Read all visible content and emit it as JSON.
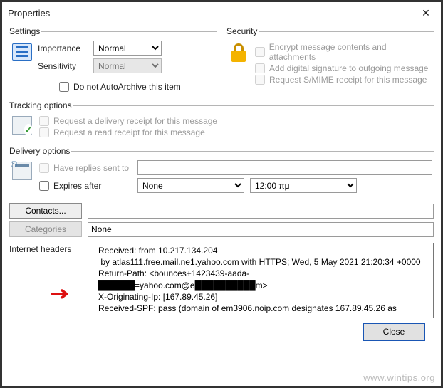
{
  "window": {
    "title": "Properties"
  },
  "settings": {
    "legend": "Settings",
    "importance_label": "Importance",
    "importance_value": "Normal",
    "sensitivity_label": "Sensitivity",
    "sensitivity_value": "Normal",
    "autoarchive_label": "Do not AutoArchive this item"
  },
  "security": {
    "legend": "Security",
    "encrypt_label": "Encrypt message contents and attachments",
    "sign_label": "Add digital signature to outgoing message",
    "smime_label": "Request S/MIME receipt for this message"
  },
  "tracking": {
    "legend": "Tracking options",
    "delivery_receipt_label": "Request a delivery receipt for this message",
    "read_receipt_label": "Request a read receipt for this message"
  },
  "delivery": {
    "legend": "Delivery options",
    "replies_label": "Have replies sent to",
    "replies_value": "",
    "expires_label": "Expires after",
    "expires_date": "None",
    "expires_time": "12:00 πμ"
  },
  "buttons": {
    "contacts": "Contacts...",
    "categories": "Categories",
    "categories_value": "None",
    "close": "Close"
  },
  "headers": {
    "label": "Internet headers",
    "text": "Received: from 10.217.134.204\n by atlas111.free.mail.ne1.yahoo.com with HTTPS; Wed, 5 May 2021 21:20:34 +0000\nReturn-Path: <bounces+1423439-aada-\n██████=yahoo.com@e██████████m>\nX-Originating-Ip: [167.89.45.26]\nReceived-SPF: pass (domain of em3906.noip.com designates 167.89.45.26 as"
  },
  "watermark": "www.wintips.org"
}
